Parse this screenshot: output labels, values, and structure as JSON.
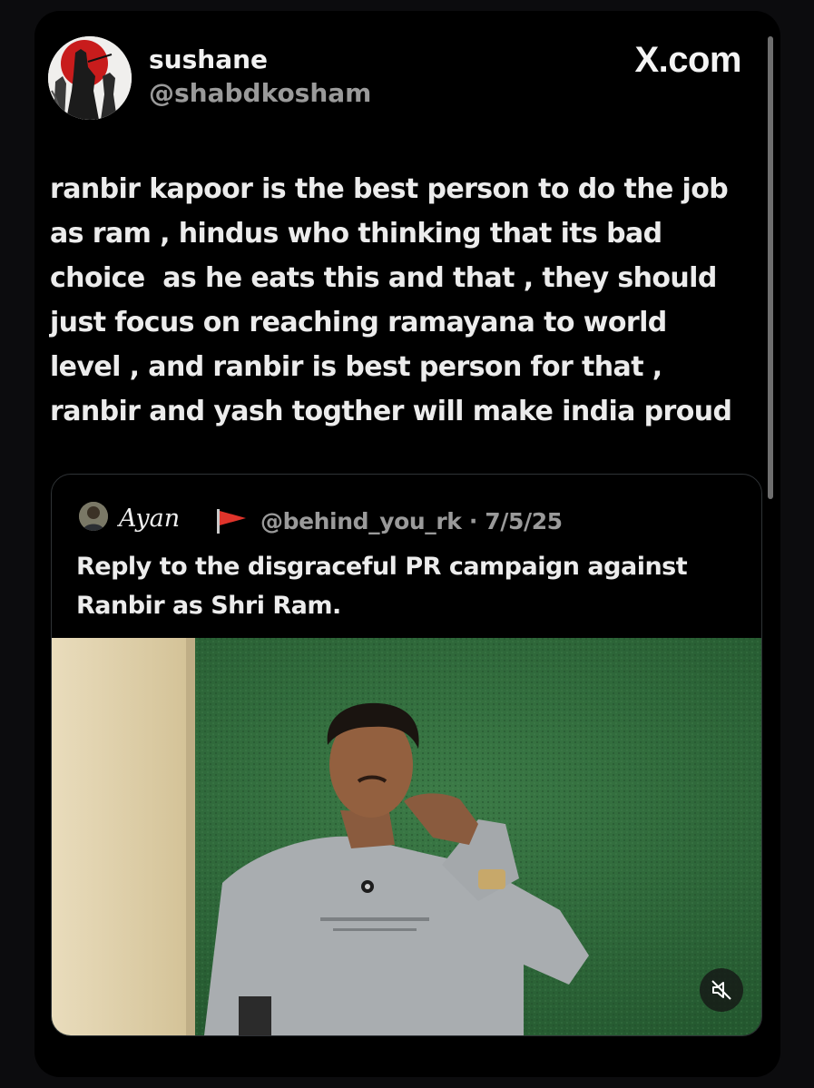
{
  "post": {
    "author_name": "sushane",
    "author_handle": "@shabdkosham",
    "brand": "X.com",
    "text_lines": [
      "ranbir kapoor is the best person to do the job",
      "as ram , hindus who thinking that its bad",
      "choice  as he eats this and that , they should",
      "just focus on reaching ramayana to world",
      "level , and ranbir is best person for that ,",
      "ranbir and yash togther will make india proud"
    ]
  },
  "quote": {
    "author_name": "Ayan",
    "flag_icon": "flag-icon",
    "meta": "@behind_you_rk · 7/5/25",
    "text_lines": [
      "Reply to the disgraceful PR campaign against",
      "Ranbir as Shri Ram."
    ],
    "media": {
      "mute_icon": "speaker-muted-icon"
    }
  },
  "colors": {
    "background": "#000000",
    "text": "#ececec",
    "muted_text": "#9a9a9a",
    "flag_red": "#e0342b",
    "wall_green": "#2f6e3c",
    "shirt_gray": "#a9adb0"
  }
}
